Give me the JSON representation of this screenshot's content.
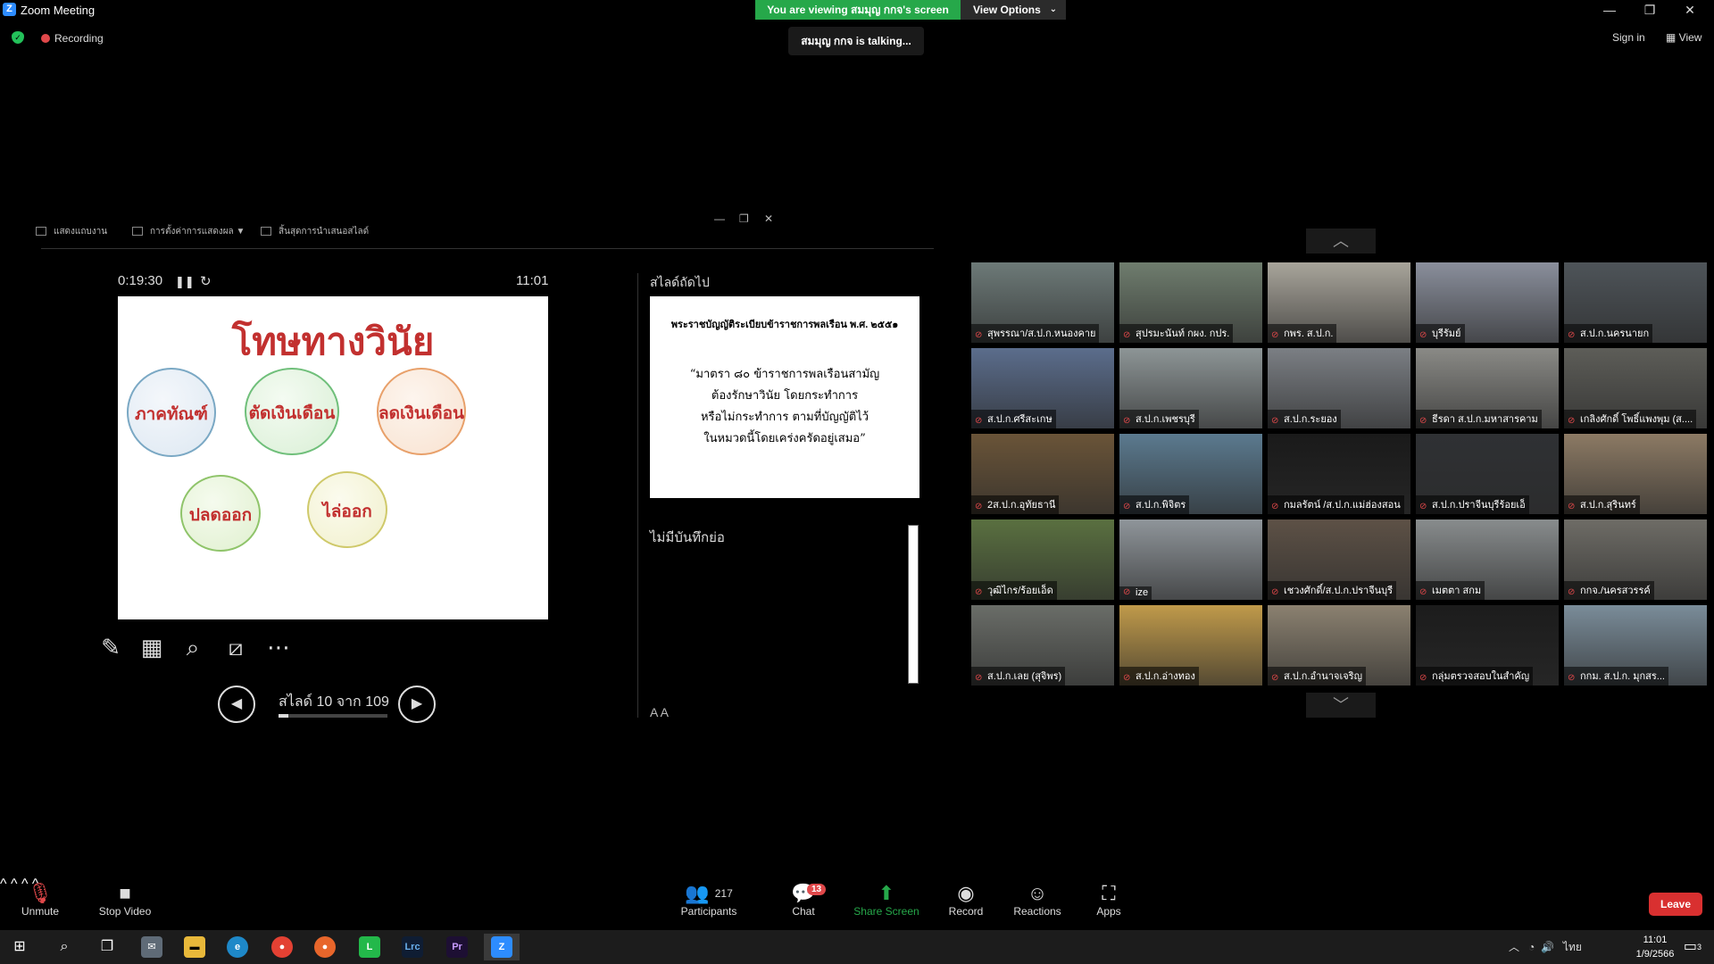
{
  "window": {
    "title": "Zoom Meeting",
    "minimize": "—",
    "restore": "❐",
    "close": "✕"
  },
  "banner": {
    "viewing": "You are viewing สมมุญ กกจ's screen",
    "view_options": "View Options"
  },
  "meeting": {
    "recording": "Recording",
    "talking": "สมมุญ กกจ is talking...",
    "sign_in": "Sign in",
    "view": "View"
  },
  "presenter": {
    "toolbar": [
      "แสดงแถบงาน",
      "การตั้งค่าการแสดงผล ▼",
      "สิ้นสุดการนำเสนอสไลด์"
    ],
    "timer": "0:19:30",
    "clock": "11:01",
    "current_slide": {
      "title": "โทษทางวินัย",
      "bubbles": [
        "ภาคทัณฑ์",
        "ตัดเงินเดือน",
        "ลดเงินเดือน",
        "ปลดออก",
        "ไล่ออก"
      ]
    },
    "slide_counter": "สไลด์ 10 จาก 109",
    "slide_progress": 0.092,
    "next_label": "สไลด์ถัดไป",
    "next_slide": {
      "heading": "พระราชบัญญัติระเบียบข้าราชการพลเรือน พ.ศ. ๒๕๕๑",
      "lines": [
        "“มาตรา ๘๐ ข้าราชการพลเรือนสามัญ",
        "ต้องรักษาวินัย โดยกระทำการ",
        "หรือไม่กระทำการ ตามที่บัญญัติไว้",
        "ในหมวดนี้โดยเคร่งครัดอยู่เสมอ”"
      ]
    },
    "notes": "ไม่มีบันทึกย่อ",
    "font_buttons": "A  A"
  },
  "gallery": [
    {
      "name": "สุพรรณา/ส.ป.ก.หนองคาย",
      "bg": "#6d7a78"
    },
    {
      "name": "สุปรมะนันท์ กผง. กปร.",
      "bg": "#6f7d6e"
    },
    {
      "name": "กพร. ส.ป.ก.",
      "bg": "#a9a59b"
    },
    {
      "name": "บุรีรัมย์",
      "bg": "#8a8f9c"
    },
    {
      "name": "ส.ป.ก.นครนายก",
      "bg": "#4e5459"
    },
    {
      "name": "ส.ป.ก.ศรีสะเกษ",
      "bg": "#5b6d8c"
    },
    {
      "name": "ส.ป.ก.เพชรบุรี",
      "bg": "#8d9596"
    },
    {
      "name": "ส.ป.ก.ระยอง",
      "bg": "#7b7f84"
    },
    {
      "name": "ธีรดา ส.ป.ก.มหาสารคาม",
      "bg": "#8a8a86"
    },
    {
      "name": "เกลิงศักดิ์ โพธิ์แพงพุม (ส....",
      "bg": "#5d5d58"
    },
    {
      "name": "2ส.ป.ก.อุทัยธานี",
      "bg": "#6a5438"
    },
    {
      "name": "ส.ป.ก.พิจิตร",
      "bg": "#5b7a8f"
    },
    {
      "name": "กมลรัตน์ /ส.ป.ก.แม่ฮ่องสอน",
      "bg": "#1a1a1a"
    },
    {
      "name": "ส.ป.ก.ปราจีนบุรีร้อยเอ็",
      "bg": "#2f3134"
    },
    {
      "name": "ส.ป.ก.สุรินทร์",
      "bg": "#8c7a64"
    },
    {
      "name": "วุฒิไกร/ร้อยเอ็ด",
      "bg": "#5a7040"
    },
    {
      "name": "ize",
      "bg": "#8f959a"
    },
    {
      "name": "เชวงศักดิ์/ส.ป.ก.ปราจีนบุรี",
      "bg": "#5d5146"
    },
    {
      "name": "เมตตา สกม",
      "bg": "#888c8d"
    },
    {
      "name": "กกจ./นครสวรรค์",
      "bg": "#6e6c66"
    },
    {
      "name": "ส.ป.ก.เลย (สุจิพร)",
      "bg": "#6a6d68"
    },
    {
      "name": "ส.ป.ก.อ่างทอง",
      "bg": "#c09a4a"
    },
    {
      "name": "ส.ป.ก.อำนาจเจริญ",
      "bg": "#8b8170"
    },
    {
      "name": "กลุ่มตรวจสอบในสำคัญ",
      "bg": "#1c1c1c"
    },
    {
      "name": "กกม. ส.ป.ก. มุกสร...",
      "bg": "#7a8c99"
    }
  ],
  "toolbar": {
    "unmute": "Unmute",
    "stop_video": "Stop Video",
    "participants": "Participants",
    "participants_count": "217",
    "chat": "Chat",
    "chat_badge": "13",
    "share_screen": "Share Screen",
    "record": "Record",
    "reactions": "Reactions",
    "apps": "Apps",
    "leave": "Leave",
    "accent": "#26a84a",
    "leave_color": "#d93030"
  },
  "taskbar": {
    "lang": "ไทย",
    "time": "11:01",
    "date": "1/9/2566",
    "notif": "3",
    "apps": [
      "windows-start",
      "search",
      "task-view",
      "mail",
      "file-explorer",
      "edge",
      "chrome",
      "firefox",
      "line",
      "lightroom",
      "premiere",
      "zoom"
    ]
  }
}
